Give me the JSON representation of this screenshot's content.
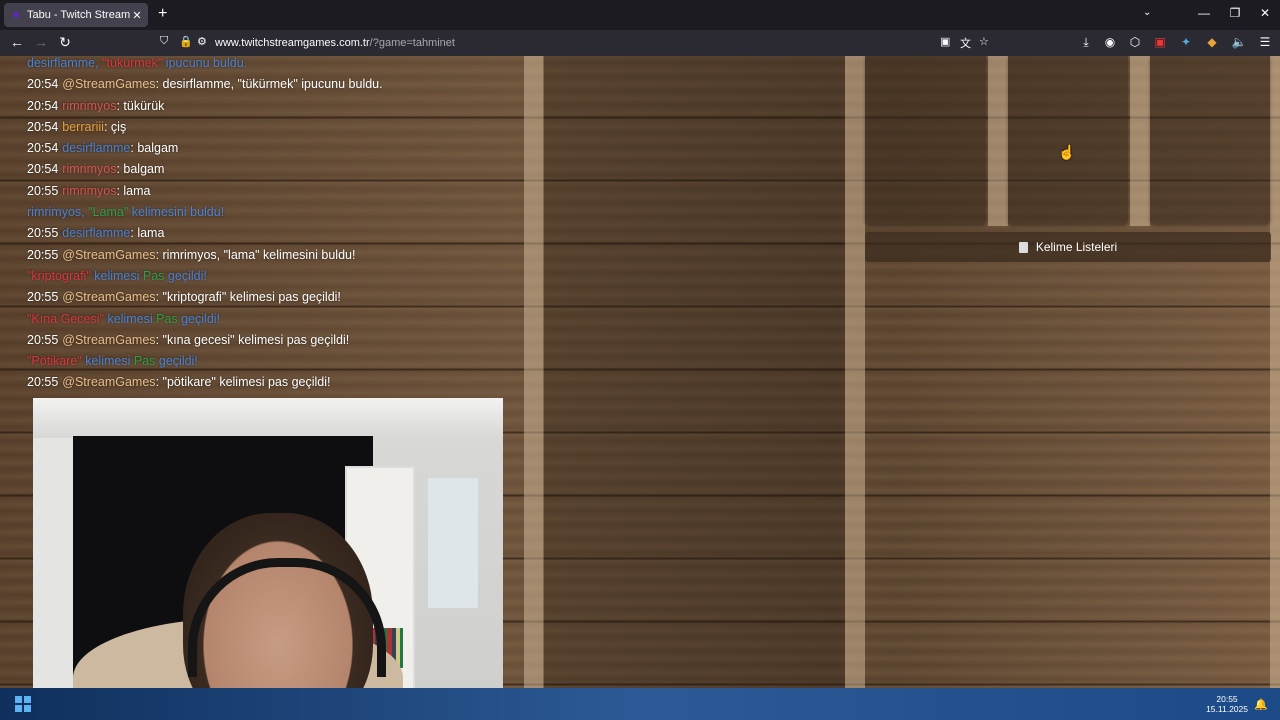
{
  "browser": {
    "tab_title": "Tabu - Twitch Stream Ga",
    "new_tab": "+",
    "tab_close": "✕",
    "url_domain": "www.twitchstreamgames.com.tr",
    "url_path": "/?game=tahminet",
    "icons": {
      "back": "←",
      "forward": "→",
      "reload": "↻",
      "shield": "⛉",
      "lock": "🔒",
      "site": "⚙",
      "reader": "▣",
      "translate": "文",
      "star": "☆",
      "download": "⤓",
      "ext1": "◉",
      "extensions": "⬡",
      "ext2": "▣",
      "ext3": "✦",
      "ext4": "◆",
      "mute": "🔈",
      "menu": "☰",
      "tabs_list": "⌄",
      "minimize": "—",
      "maximize": "❐",
      "close": "✕"
    }
  },
  "chat": {
    "lines": [
      {
        "kind": "sys-hint",
        "user": "desirflamme,",
        "word": "\"tükürmek\"",
        "text": "ipucunu buldu."
      },
      {
        "kind": "bot",
        "time": "20:54",
        "user": "@StreamGames",
        "text": "desirflamme, \"tükürmek\" ipucunu buldu."
      },
      {
        "kind": "msg",
        "time": "20:54",
        "user": "rimrimyos",
        "color": "#d9534f",
        "text": "tükürük"
      },
      {
        "kind": "msg",
        "time": "20:54",
        "user": "berrariii",
        "color": "#e8a33d",
        "text": "çiş"
      },
      {
        "kind": "msg",
        "time": "20:54",
        "user": "desirflamme",
        "color": "#4a82d4",
        "text": "balgam"
      },
      {
        "kind": "msg",
        "time": "20:54",
        "user": "rimrimyos",
        "color": "#d9534f",
        "text": "balgam"
      },
      {
        "kind": "msg",
        "time": "20:55",
        "user": "rimrimyos",
        "color": "#d9534f",
        "text": "lama"
      },
      {
        "kind": "sys-found",
        "user": "rimrimyos,",
        "word": "\"Lama\"",
        "text": "kelimesini buldu!"
      },
      {
        "kind": "msg",
        "time": "20:55",
        "user": "desirflamme",
        "color": "#4a82d4",
        "text": "lama"
      },
      {
        "kind": "bot",
        "time": "20:55",
        "user": "@StreamGames",
        "text": "rimrimyos, \"lama\" kelimesini buldu!"
      },
      {
        "kind": "sys-pass",
        "word": "\"kriptografi\"",
        "k": "kelimesi",
        "p": "Pas",
        "g": "geçildi!"
      },
      {
        "kind": "bot",
        "time": "20:55",
        "user": "@StreamGames",
        "text": "\"kriptografi\" kelimesi pas geçildi!"
      },
      {
        "kind": "sys-pass",
        "word": "\"Kına Gecesi\"",
        "k": "kelimesi",
        "p": "Pas",
        "g": "geçildi!"
      },
      {
        "kind": "bot",
        "time": "20:55",
        "user": "@StreamGames",
        "text": "\"kına gecesi\" kelimesi pas geçildi!"
      },
      {
        "kind": "sys-pass",
        "word": "\"Pötikare\"",
        "k": "kelimesi",
        "p": "Pas",
        "g": "geçildi!"
      },
      {
        "kind": "bot",
        "time": "20:55",
        "user": "@StreamGames",
        "text": "\"pötikare\" kelimesi pas geçildi!"
      }
    ],
    "bot_color": "#e8c08a"
  },
  "game": {
    "word_list_button": "Kelime Listeleri"
  },
  "taskbar": {
    "time": "20:55",
    "date": "15.11.2025"
  }
}
